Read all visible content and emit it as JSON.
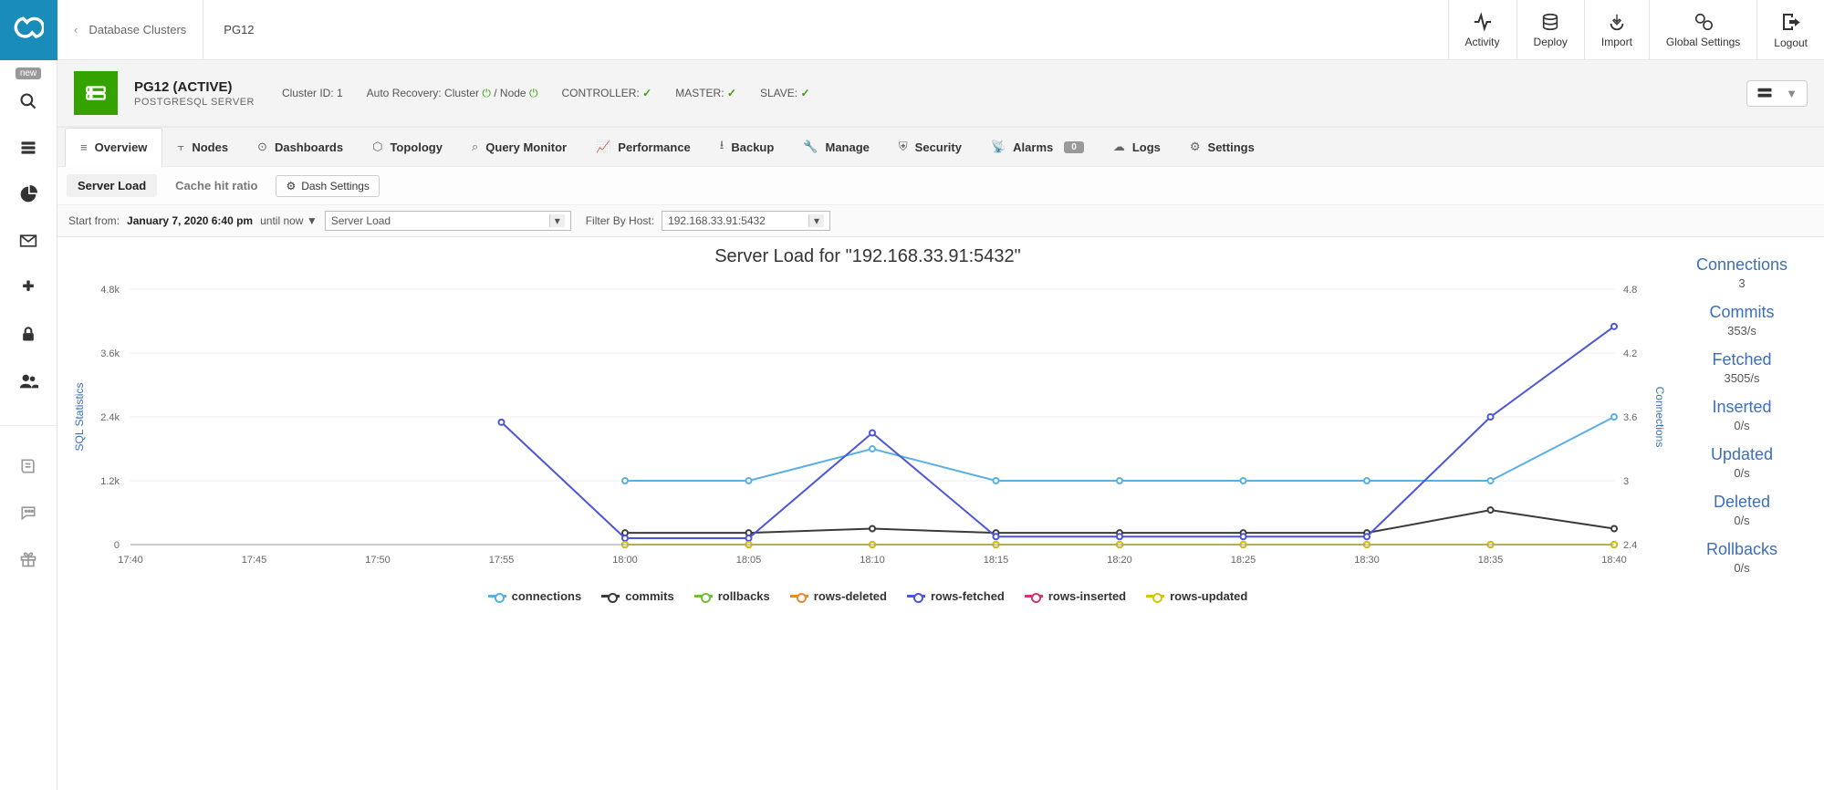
{
  "sidebar": {
    "new_badge": "new"
  },
  "breadcrumb": {
    "back": "Database Clusters",
    "current": "PG12"
  },
  "top_actions": [
    {
      "label": "Activity"
    },
    {
      "label": "Deploy"
    },
    {
      "label": "Import"
    },
    {
      "label": "Global Settings"
    },
    {
      "label": "Logout"
    }
  ],
  "cluster": {
    "title": "PG12 (ACTIVE)",
    "subtitle": "POSTGRESQL SERVER",
    "cluster_id_label": "Cluster ID: 1",
    "auto_recovery_label": "Auto Recovery: Cluster",
    "auto_recovery_sep": " / Node",
    "controller_label": "CONTROLLER:",
    "master_label": "MASTER:",
    "slave_label": "SLAVE:"
  },
  "tabs": [
    {
      "label": "Overview"
    },
    {
      "label": "Nodes"
    },
    {
      "label": "Dashboards"
    },
    {
      "label": "Topology"
    },
    {
      "label": "Query Monitor"
    },
    {
      "label": "Performance"
    },
    {
      "label": "Backup"
    },
    {
      "label": "Manage"
    },
    {
      "label": "Security"
    },
    {
      "label": "Alarms",
      "badge": "0"
    },
    {
      "label": "Logs"
    },
    {
      "label": "Settings"
    }
  ],
  "subtabs": {
    "server_load": "Server Load",
    "cache_hit": "Cache hit ratio",
    "dash_settings": "Dash Settings"
  },
  "filter": {
    "start_label": "Start from:",
    "start_value": "January 7, 2020 6:40 pm",
    "until": "until now",
    "select_value": "Server Load",
    "host_label": "Filter By Host:",
    "host_value": "192.168.33.91:5432"
  },
  "chart_data": {
    "type": "line",
    "title": "Server Load for \"192.168.33.91:5432\"",
    "ylabel": "SQL Statistics",
    "ylabel2": "Connections",
    "x": [
      "17:40",
      "17:45",
      "17:50",
      "17:55",
      "18:00",
      "18:05",
      "18:10",
      "18:15",
      "18:20",
      "18:25",
      "18:30",
      "18:35",
      "18:40"
    ],
    "ylim": [
      0,
      4800
    ],
    "yticks": [
      0,
      1200,
      2400,
      3600,
      4800
    ],
    "ytick_labels": [
      "0",
      "1.2k",
      "2.4k",
      "3.6k",
      "4.8k"
    ],
    "y2lim": [
      2.4,
      4.8
    ],
    "y2ticks": [
      2.4,
      3,
      3.6,
      4.2,
      4.8
    ],
    "series": [
      {
        "name": "connections",
        "axis": "y2",
        "color": "#5aafe3",
        "values": [
          null,
          null,
          null,
          null,
          3,
          3,
          3.3,
          3,
          3,
          3,
          3,
          3,
          3.6
        ]
      },
      {
        "name": "commits",
        "axis": "y1",
        "color": "#3a3a3a",
        "values": [
          null,
          null,
          null,
          null,
          220,
          220,
          300,
          220,
          220,
          220,
          220,
          650,
          300
        ]
      },
      {
        "name": "rollbacks",
        "axis": "y1",
        "color": "#6fbf3a",
        "values": [
          null,
          null,
          null,
          null,
          0,
          0,
          0,
          0,
          0,
          0,
          0,
          0,
          0
        ]
      },
      {
        "name": "rows-deleted",
        "axis": "y1",
        "color": "#e68a2e",
        "values": [
          null,
          null,
          null,
          null,
          0,
          0,
          0,
          0,
          0,
          0,
          0,
          0,
          0
        ]
      },
      {
        "name": "rows-fetched",
        "axis": "y1",
        "color": "#4a56d6",
        "values": [
          null,
          null,
          null,
          2300,
          120,
          120,
          2100,
          150,
          150,
          150,
          150,
          2400,
          4100
        ]
      },
      {
        "name": "rows-inserted",
        "axis": "y1",
        "color": "#d6336c",
        "values": [
          null,
          null,
          null,
          null,
          0,
          0,
          0,
          0,
          0,
          0,
          0,
          0,
          0
        ]
      },
      {
        "name": "rows-updated",
        "axis": "y1",
        "color": "#d4c40a",
        "values": [
          null,
          null,
          null,
          null,
          0,
          0,
          0,
          0,
          0,
          0,
          0,
          0,
          0
        ]
      }
    ]
  },
  "stats": [
    {
      "label": "Connections",
      "value": "3"
    },
    {
      "label": "Commits",
      "value": "353/s"
    },
    {
      "label": "Fetched",
      "value": "3505/s"
    },
    {
      "label": "Inserted",
      "value": "0/s"
    },
    {
      "label": "Updated",
      "value": "0/s"
    },
    {
      "label": "Deleted",
      "value": "0/s"
    },
    {
      "label": "Rollbacks",
      "value": "0/s"
    }
  ]
}
